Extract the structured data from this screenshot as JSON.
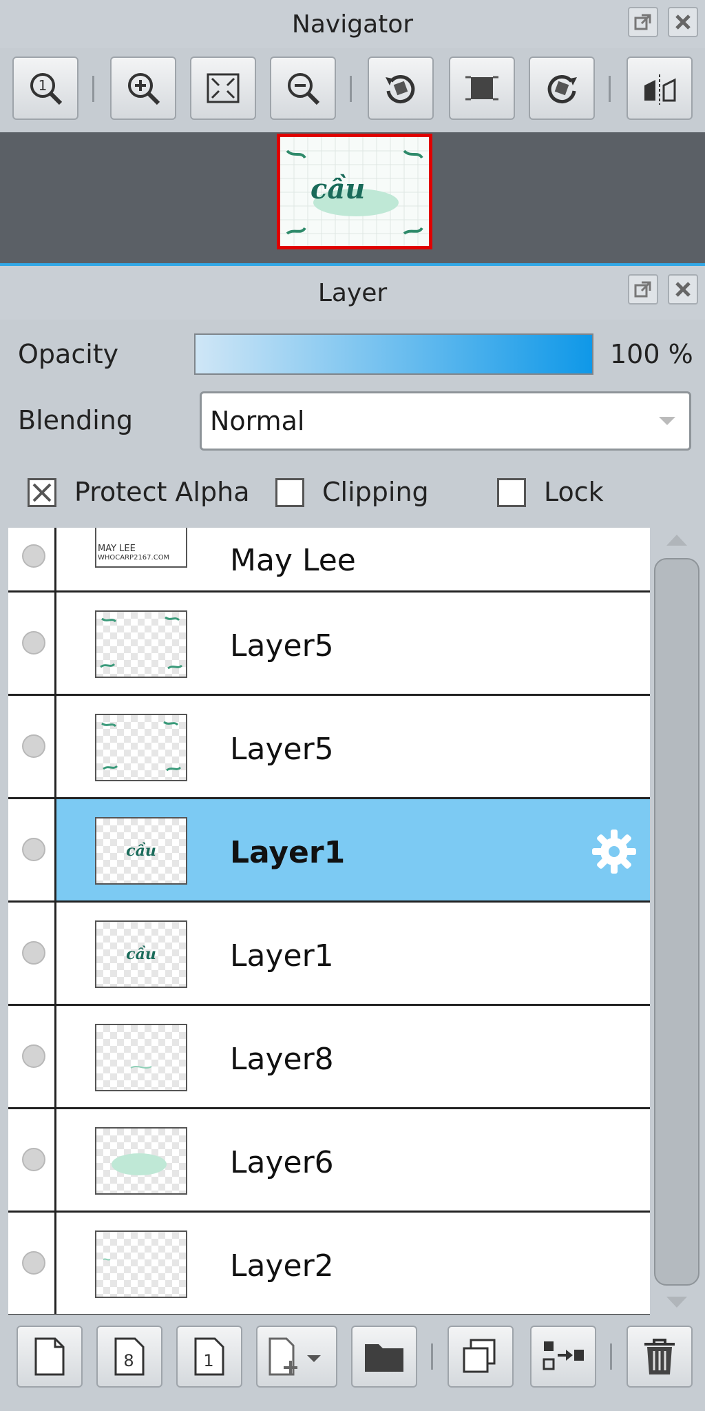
{
  "navigator": {
    "title": "Navigator",
    "tools": [
      {
        "name": "actual-size-icon"
      },
      {
        "name": "zoom-in-icon"
      },
      {
        "name": "fit-screen-icon"
      },
      {
        "name": "zoom-out-icon"
      },
      {
        "name": "rotate-left-icon"
      },
      {
        "name": "reset-rotation-icon"
      },
      {
        "name": "rotate-right-icon"
      },
      {
        "name": "flip-horizontal-icon"
      }
    ],
    "preview_text": "cầu"
  },
  "layer_panel": {
    "title": "Layer",
    "opacity_label": "Opacity",
    "opacity_value": "100 %",
    "opacity_fraction": 1.0,
    "blending_label": "Blending",
    "blending_value": "Normal",
    "options": {
      "protect_alpha": {
        "label": "Protect Alpha",
        "checked": true
      },
      "clipping": {
        "label": "Clipping",
        "checked": false
      },
      "lock": {
        "label": "Lock",
        "checked": false
      }
    },
    "layers": [
      {
        "name": "May Lee",
        "selected": false
      },
      {
        "name": "Layer5",
        "selected": false
      },
      {
        "name": "Layer5",
        "selected": false
      },
      {
        "name": "Layer1",
        "selected": true
      },
      {
        "name": "Layer1",
        "selected": false
      },
      {
        "name": "Layer8",
        "selected": false
      },
      {
        "name": "Layer6",
        "selected": false
      },
      {
        "name": "Layer2",
        "selected": false
      }
    ],
    "thumb_texts": {
      "maylee_line1": "MAY LEE",
      "maylee_line2": "WHOCARP2167.COM",
      "layer1": "cầu"
    },
    "bottom_tools": [
      {
        "name": "new-color-layer-icon"
      },
      {
        "name": "new-8bit-layer-icon"
      },
      {
        "name": "new-1bit-layer-icon"
      },
      {
        "name": "add-layer-menu-icon"
      },
      {
        "name": "new-folder-icon"
      },
      {
        "name": "duplicate-layer-icon"
      },
      {
        "name": "merge-down-icon"
      },
      {
        "name": "delete-layer-icon"
      }
    ]
  },
  "colors": {
    "selection": "#7ccaf3",
    "accent": "#33a8e6",
    "preview_border": "#e00000"
  }
}
